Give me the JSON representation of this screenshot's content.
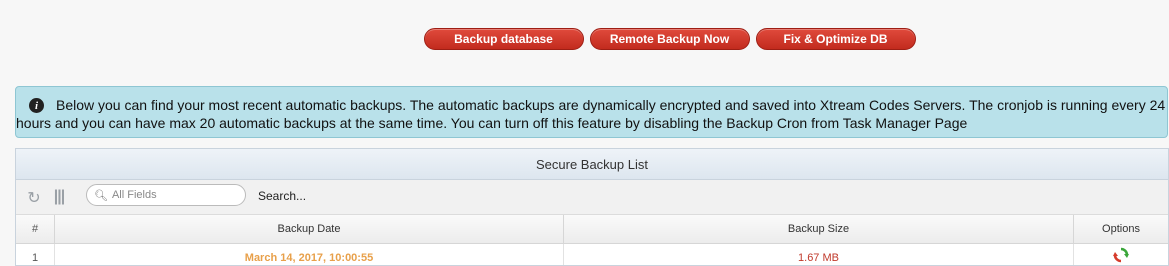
{
  "actions": {
    "backup_database": "Backup database",
    "remote_backup_now": "Remote Backup Now",
    "fix_optimize_db": "Fix & Optimize DB"
  },
  "notice": {
    "icon": "info-icon",
    "text": "Below you can find your most recent automatic backups. The automatic backups are dynamically encrypted and saved into Xtream Codes Servers. The cronjob is running every 24 hours and you can have max 20 automatic backups at the same time. You can turn off this feature by disabling the Backup Cron from Task Manager Page"
  },
  "panel": {
    "title": "Secure Backup List",
    "toolbar": {
      "refresh_icon": "refresh-icon",
      "columns_icon": "columns-icon",
      "search_placeholder": "All Fields",
      "search_label": "Search..."
    },
    "columns": {
      "num": "#",
      "date": "Backup Date",
      "size": "Backup Size",
      "options": "Options"
    },
    "rows": [
      {
        "num": "1",
        "date": "March 14, 2017, 10:00:55",
        "size": "1.67 MB",
        "option_icon": "restore-icon"
      }
    ]
  },
  "colors": {
    "button_red": "#d13a2c",
    "notice_bg": "#b9e1ea",
    "date_orange": "#e8a04a",
    "size_red": "#c0392b"
  }
}
